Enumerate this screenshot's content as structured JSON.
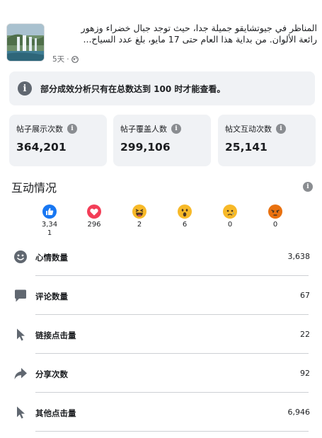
{
  "post": {
    "text_line1": "المناظر في جيوتشايقو جميلة جدا، حيث توجد جبال خضراء وزهور",
    "text_line2": "رائعة الألوان. من بداية هذا العام حتى 17 مايو، بلغ عدد السياح...",
    "age": "5天",
    "separator": "·"
  },
  "notice": {
    "icon": "info-icon",
    "text": "部分成效分析只有在总数达到 100 时才能查看。"
  },
  "stats": [
    {
      "label": "帖子展示次数",
      "value": "364,201"
    },
    {
      "label": "帖子覆盖人数",
      "value": "299,106"
    },
    {
      "label": "帖文互动次数",
      "value": "25,141"
    }
  ],
  "engagement": {
    "title": "互动情况"
  },
  "reactions": [
    {
      "icon": "like-icon",
      "count": "3,34\n1",
      "color": "#1877f2"
    },
    {
      "icon": "love-icon",
      "count": "296",
      "color": "#f33e58"
    },
    {
      "icon": "haha-icon",
      "count": "2",
      "color": "#f7b928"
    },
    {
      "icon": "wow-icon",
      "count": "6",
      "color": "#f7b928"
    },
    {
      "icon": "sad-icon",
      "count": "0",
      "color": "#f7b928"
    },
    {
      "icon": "angry-icon",
      "count": "0",
      "color": "#e9710f"
    }
  ],
  "metrics": [
    {
      "icon": "smiley-icon",
      "label": "心情数量",
      "value": "3,638"
    },
    {
      "icon": "comment-icon",
      "label": "评论数量",
      "value": "67"
    },
    {
      "icon": "cursor-icon",
      "label": "链接点击量",
      "value": "22"
    },
    {
      "icon": "share-icon",
      "label": "分享次数",
      "value": "92"
    },
    {
      "icon": "cursor-icon",
      "label": "其他点击量",
      "value": "6,946"
    }
  ]
}
